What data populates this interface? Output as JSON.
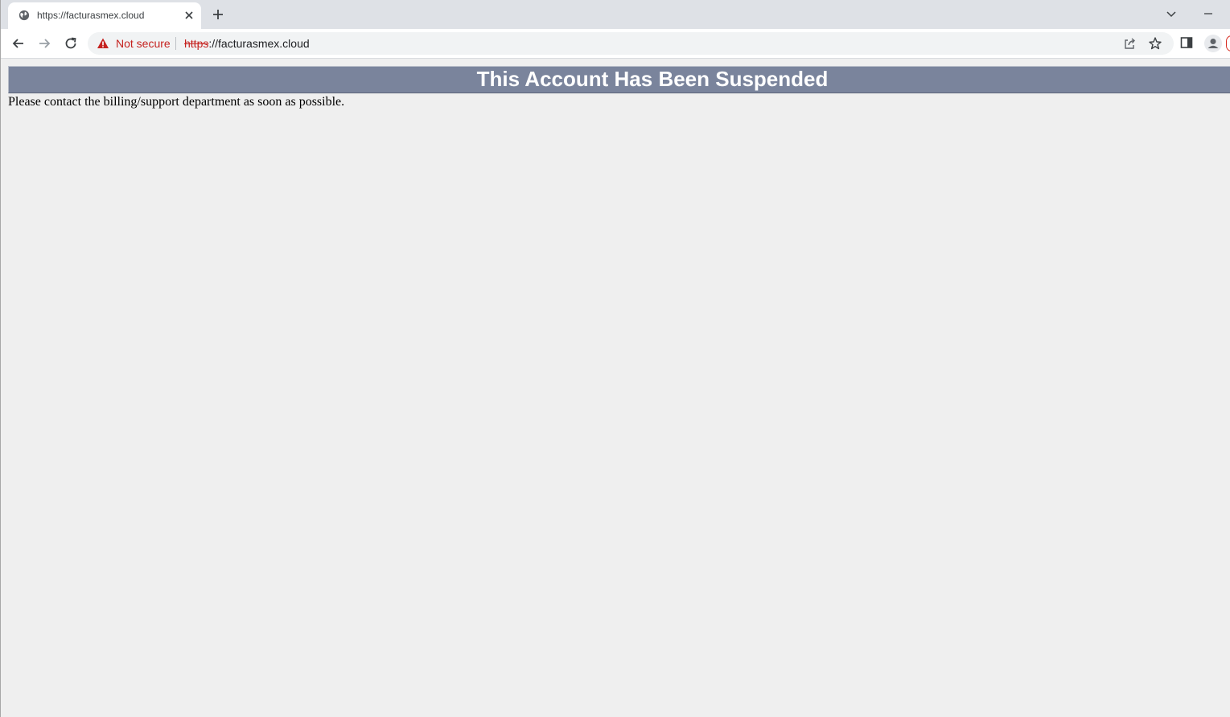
{
  "browser": {
    "tab": {
      "title": "https://facturasmex.cloud",
      "favicon": "globe-icon"
    },
    "toolbar": {
      "security_label": "Not secure",
      "url_scheme": "https",
      "url_rest": "://facturasmex.cloud"
    },
    "colors": {
      "tabstrip": "#dee1e6",
      "warning": "#c5221f"
    }
  },
  "page": {
    "heading": "This Account Has Been Suspended",
    "message": "Please contact the billing/support department as soon as possible.",
    "colors": {
      "banner": "#7a849c",
      "background": "#efefef"
    }
  }
}
